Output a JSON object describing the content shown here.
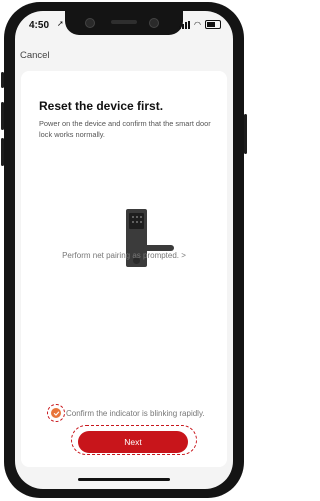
{
  "status_bar": {
    "time": "4:50",
    "location_icon": "location-arrow-icon",
    "icons": [
      "signal-bars-icon",
      "wifi-icon",
      "battery-icon"
    ]
  },
  "nav": {
    "cancel_label": "Cancel"
  },
  "content": {
    "title": "Reset the device first.",
    "description": "Power on the device and confirm that the smart door lock works normally.",
    "illustration": "smart-door-lock",
    "pairing_link": "Perform net pairing as prompted. >"
  },
  "confirm": {
    "label": "Confirm the indicator is blinking rapidly.",
    "checked": true
  },
  "next_button": {
    "label": "Next"
  },
  "colors": {
    "accent": "#c8151b",
    "check": "#e8753a",
    "background": "#f4f4f4",
    "card": "#ffffff"
  }
}
